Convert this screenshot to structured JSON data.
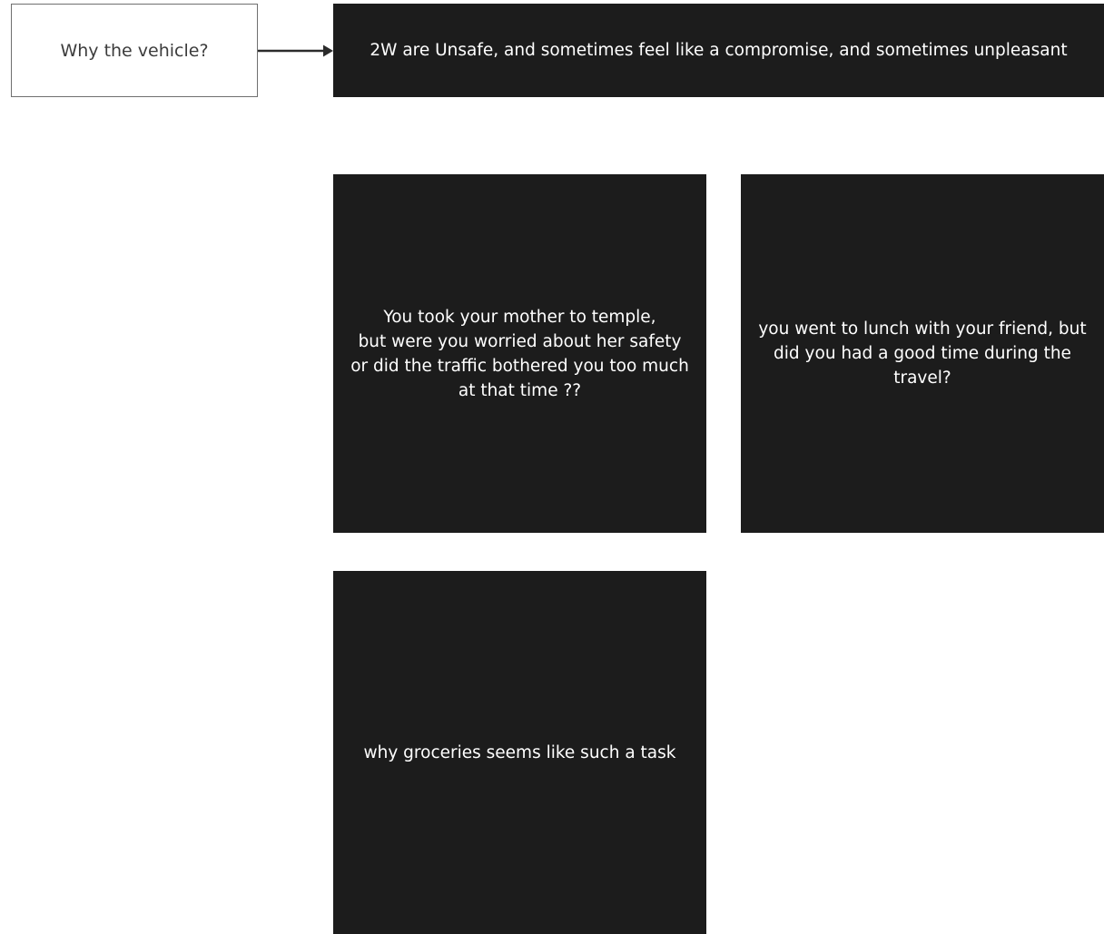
{
  "question": {
    "label": "Why the vehicle?"
  },
  "answer": {
    "label": "2W are Unsafe, and sometimes feel like a compromise, and sometimes unpleasant"
  },
  "cards": {
    "temple": {
      "lines": [
        "You took your mother to temple,",
        "but were you worried about her safety",
        "or did the traffic bothered you too much",
        "at that time ??"
      ]
    },
    "lunch": {
      "lines": [
        "you went to lunch with your friend, but",
        "did you had a good time during the",
        "travel?"
      ]
    },
    "groceries": {
      "label": "why groceries seems like such a task"
    }
  },
  "colors": {
    "card_background": "#1c1c1c",
    "card_text": "#ffffff",
    "question_border": "#6f6f6f",
    "question_text": "#3c3c3c",
    "connector": "#2b2b2b"
  }
}
